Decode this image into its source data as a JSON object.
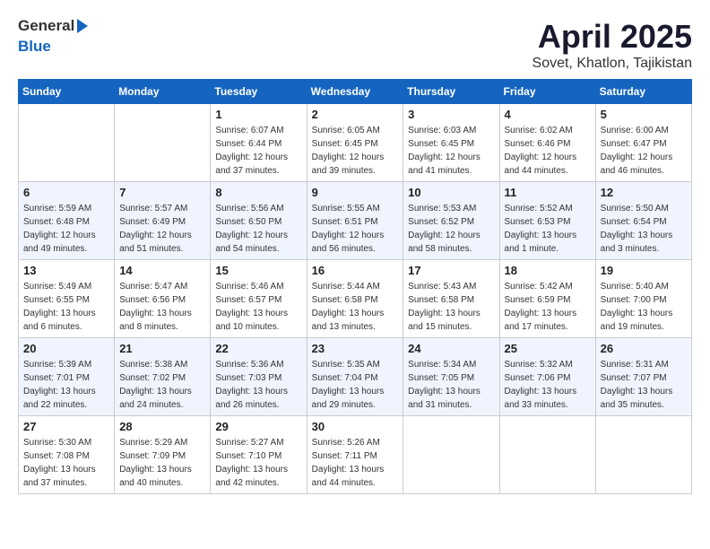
{
  "header": {
    "logo_general": "General",
    "logo_blue": "Blue",
    "title": "April 2025",
    "subtitle": "Sovet, Khatlon, Tajikistan"
  },
  "days_of_week": [
    "Sunday",
    "Monday",
    "Tuesday",
    "Wednesday",
    "Thursday",
    "Friday",
    "Saturday"
  ],
  "weeks": [
    [
      {
        "day": "",
        "info": ""
      },
      {
        "day": "",
        "info": ""
      },
      {
        "day": "1",
        "info": "Sunrise: 6:07 AM\nSunset: 6:44 PM\nDaylight: 12 hours and 37 minutes."
      },
      {
        "day": "2",
        "info": "Sunrise: 6:05 AM\nSunset: 6:45 PM\nDaylight: 12 hours and 39 minutes."
      },
      {
        "day": "3",
        "info": "Sunrise: 6:03 AM\nSunset: 6:45 PM\nDaylight: 12 hours and 41 minutes."
      },
      {
        "day": "4",
        "info": "Sunrise: 6:02 AM\nSunset: 6:46 PM\nDaylight: 12 hours and 44 minutes."
      },
      {
        "day": "5",
        "info": "Sunrise: 6:00 AM\nSunset: 6:47 PM\nDaylight: 12 hours and 46 minutes."
      }
    ],
    [
      {
        "day": "6",
        "info": "Sunrise: 5:59 AM\nSunset: 6:48 PM\nDaylight: 12 hours and 49 minutes."
      },
      {
        "day": "7",
        "info": "Sunrise: 5:57 AM\nSunset: 6:49 PM\nDaylight: 12 hours and 51 minutes."
      },
      {
        "day": "8",
        "info": "Sunrise: 5:56 AM\nSunset: 6:50 PM\nDaylight: 12 hours and 54 minutes."
      },
      {
        "day": "9",
        "info": "Sunrise: 5:55 AM\nSunset: 6:51 PM\nDaylight: 12 hours and 56 minutes."
      },
      {
        "day": "10",
        "info": "Sunrise: 5:53 AM\nSunset: 6:52 PM\nDaylight: 12 hours and 58 minutes."
      },
      {
        "day": "11",
        "info": "Sunrise: 5:52 AM\nSunset: 6:53 PM\nDaylight: 13 hours and 1 minute."
      },
      {
        "day": "12",
        "info": "Sunrise: 5:50 AM\nSunset: 6:54 PM\nDaylight: 13 hours and 3 minutes."
      }
    ],
    [
      {
        "day": "13",
        "info": "Sunrise: 5:49 AM\nSunset: 6:55 PM\nDaylight: 13 hours and 6 minutes."
      },
      {
        "day": "14",
        "info": "Sunrise: 5:47 AM\nSunset: 6:56 PM\nDaylight: 13 hours and 8 minutes."
      },
      {
        "day": "15",
        "info": "Sunrise: 5:46 AM\nSunset: 6:57 PM\nDaylight: 13 hours and 10 minutes."
      },
      {
        "day": "16",
        "info": "Sunrise: 5:44 AM\nSunset: 6:58 PM\nDaylight: 13 hours and 13 minutes."
      },
      {
        "day": "17",
        "info": "Sunrise: 5:43 AM\nSunset: 6:58 PM\nDaylight: 13 hours and 15 minutes."
      },
      {
        "day": "18",
        "info": "Sunrise: 5:42 AM\nSunset: 6:59 PM\nDaylight: 13 hours and 17 minutes."
      },
      {
        "day": "19",
        "info": "Sunrise: 5:40 AM\nSunset: 7:00 PM\nDaylight: 13 hours and 19 minutes."
      }
    ],
    [
      {
        "day": "20",
        "info": "Sunrise: 5:39 AM\nSunset: 7:01 PM\nDaylight: 13 hours and 22 minutes."
      },
      {
        "day": "21",
        "info": "Sunrise: 5:38 AM\nSunset: 7:02 PM\nDaylight: 13 hours and 24 minutes."
      },
      {
        "day": "22",
        "info": "Sunrise: 5:36 AM\nSunset: 7:03 PM\nDaylight: 13 hours and 26 minutes."
      },
      {
        "day": "23",
        "info": "Sunrise: 5:35 AM\nSunset: 7:04 PM\nDaylight: 13 hours and 29 minutes."
      },
      {
        "day": "24",
        "info": "Sunrise: 5:34 AM\nSunset: 7:05 PM\nDaylight: 13 hours and 31 minutes."
      },
      {
        "day": "25",
        "info": "Sunrise: 5:32 AM\nSunset: 7:06 PM\nDaylight: 13 hours and 33 minutes."
      },
      {
        "day": "26",
        "info": "Sunrise: 5:31 AM\nSunset: 7:07 PM\nDaylight: 13 hours and 35 minutes."
      }
    ],
    [
      {
        "day": "27",
        "info": "Sunrise: 5:30 AM\nSunset: 7:08 PM\nDaylight: 13 hours and 37 minutes."
      },
      {
        "day": "28",
        "info": "Sunrise: 5:29 AM\nSunset: 7:09 PM\nDaylight: 13 hours and 40 minutes."
      },
      {
        "day": "29",
        "info": "Sunrise: 5:27 AM\nSunset: 7:10 PM\nDaylight: 13 hours and 42 minutes."
      },
      {
        "day": "30",
        "info": "Sunrise: 5:26 AM\nSunset: 7:11 PM\nDaylight: 13 hours and 44 minutes."
      },
      {
        "day": "",
        "info": ""
      },
      {
        "day": "",
        "info": ""
      },
      {
        "day": "",
        "info": ""
      }
    ]
  ]
}
